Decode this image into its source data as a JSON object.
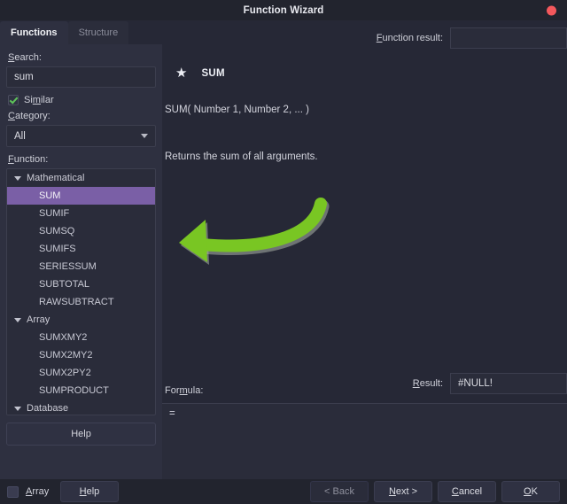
{
  "window": {
    "title": "Function Wizard",
    "close_icon": "close-dot-icon"
  },
  "tabs": [
    {
      "label": "Functions",
      "active": true
    },
    {
      "label": "Structure",
      "active": false
    }
  ],
  "sidebar": {
    "search": {
      "label": "Search:",
      "label_mnemonic": "S",
      "value": "sum",
      "placeholder": ""
    },
    "similar": {
      "label": "Similar",
      "checked": true
    },
    "category": {
      "label": "Category:",
      "label_mnemonic": "C",
      "value": "All",
      "caret_icon": "chevron-down-icon"
    },
    "function": {
      "label": "Function:",
      "label_mnemonic": "F"
    },
    "tree": [
      {
        "label": "Mathematical",
        "type": "group",
        "expanded": true
      },
      {
        "label": "SUM",
        "type": "leaf",
        "selected": true
      },
      {
        "label": "SUMIF",
        "type": "leaf"
      },
      {
        "label": "SUMSQ",
        "type": "leaf"
      },
      {
        "label": "SUMIFS",
        "type": "leaf"
      },
      {
        "label": "SERIESSUM",
        "type": "leaf"
      },
      {
        "label": "SUBTOTAL",
        "type": "leaf"
      },
      {
        "label": "RAWSUBTRACT",
        "type": "leaf"
      },
      {
        "label": "Array",
        "type": "group",
        "expanded": true
      },
      {
        "label": "SUMXMY2",
        "type": "leaf"
      },
      {
        "label": "SUMX2MY2",
        "type": "leaf"
      },
      {
        "label": "SUMX2PY2",
        "type": "leaf"
      },
      {
        "label": "SUMPRODUCT",
        "type": "leaf"
      },
      {
        "label": "Database",
        "type": "group",
        "expanded": true
      }
    ],
    "help_button": "Help"
  },
  "main": {
    "function_result": {
      "label": "Function result:",
      "label_mnemonic": "F",
      "value": ""
    },
    "function_title": "SUM",
    "star_icon": "star-icon",
    "signature": "SUM( Number 1, Number 2, ...  )",
    "description": "Returns the sum of all arguments.",
    "result": {
      "label": "Result:",
      "label_mnemonic": "R",
      "value": "#NULL!"
    },
    "formula": {
      "label": "Formula:",
      "value": "="
    }
  },
  "footer": {
    "array_checkbox": {
      "label": "Array",
      "checked": false
    },
    "help_button": "Help",
    "back_button": "< Back",
    "next_button": "Next >",
    "cancel_button": "Cancel",
    "ok_button": "OK"
  },
  "annotation": {
    "type": "curved-arrow",
    "direction": "left",
    "color": "#79c623",
    "points_to": "SUM"
  },
  "colors": {
    "window_bg": "#22242e",
    "dialog_bg": "#262836",
    "panel_bg": "#2e3040",
    "field_bg": "#2a2c3a",
    "selection": "#7a5fa6",
    "close_red": "#f4585c",
    "check_green": "#5ec45a",
    "arrow_green": "#79c623"
  }
}
